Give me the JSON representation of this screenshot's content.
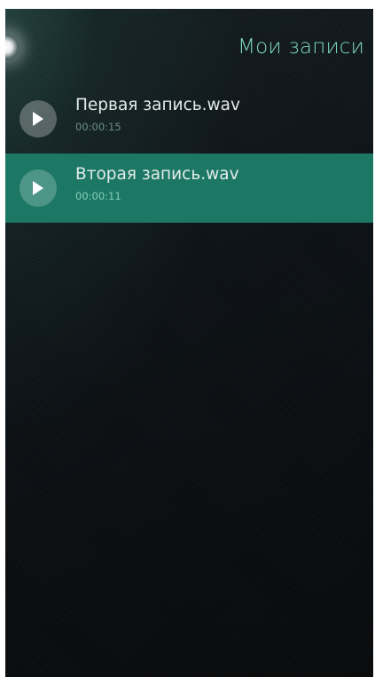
{
  "header": {
    "title": "Мои записи"
  },
  "recordings": [
    {
      "name": "Первая запись.wav",
      "duration": "00:00:15",
      "selected": false
    },
    {
      "name": "Вторая запись.wav",
      "duration": "00:00:11",
      "selected": true
    }
  ],
  "icons": {
    "play": "play-icon"
  },
  "colors": {
    "accent": "#7fd9c2",
    "highlight": "#1c7865",
    "background": "#0a0f13"
  }
}
